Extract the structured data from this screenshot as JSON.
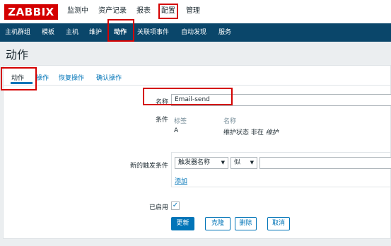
{
  "header": {
    "logo": "ZABBIX",
    "menu": [
      "监测中",
      "资产记录",
      "报表",
      "配置",
      "管理"
    ]
  },
  "submenu": [
    "主机群组",
    "模板",
    "主机",
    "维护",
    "动作",
    "关联项事件",
    "自动发现",
    "服务"
  ],
  "page": {
    "title": "动作"
  },
  "tabs": [
    "动作",
    "操作",
    "恢复操作",
    "确认操作"
  ],
  "form": {
    "name_label": "名称",
    "name_value": "Email-send",
    "conditions_label": "条件",
    "conditions_headers": [
      "标签",
      "名称"
    ],
    "conditions_rows": [
      {
        "label": "A",
        "name_prefix": "维护状态 非在 ",
        "name_italic": "维护"
      }
    ],
    "new_condition_label": "新的触发条件",
    "new_condition_type": "触发器名称",
    "new_condition_operator": "似",
    "new_condition_value": "",
    "add_link": "添加",
    "enabled_label": "已启用",
    "enabled": true
  },
  "buttons": {
    "update": "更新",
    "clone": "克隆",
    "delete": "删除",
    "cancel": "取消"
  },
  "colors": {
    "brand": "#d40000",
    "nav": "#0a466a",
    "accent": "#0275b8",
    "highlight": "#d40000"
  }
}
